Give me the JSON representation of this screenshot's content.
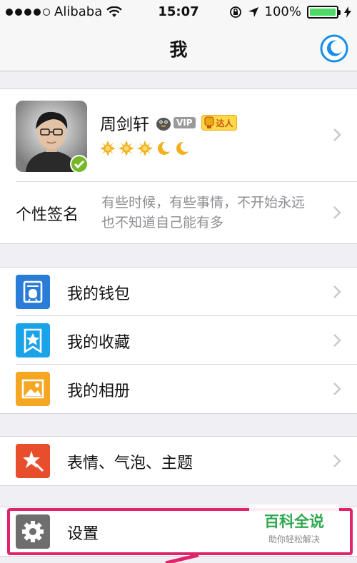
{
  "status_bar": {
    "carrier": "Alibaba",
    "time": "15:07",
    "battery": "100%",
    "battery_level": 1.0
  },
  "nav": {
    "title": "我",
    "right_icon": "moon-icon"
  },
  "profile": {
    "name": "周剑轩",
    "vip_badge": "VIP",
    "daren_badge": "达人",
    "level_icons": [
      "sun",
      "sun",
      "sun",
      "moon",
      "moon"
    ],
    "verified": true
  },
  "signature": {
    "label": "个性签名",
    "text": "有些时候，有些事情，不开始永远也不知道自己能有多"
  },
  "menu_group_1": [
    {
      "label": "我的钱包",
      "icon": "wallet-icon",
      "color": "#2a7dd7"
    },
    {
      "label": "我的收藏",
      "icon": "favorites-star-icon",
      "color": "#1aa3e8"
    },
    {
      "label": "我的相册",
      "icon": "photo-album-icon",
      "color": "#f5a623"
    }
  ],
  "menu_group_2": [
    {
      "label": "表情、气泡、主题",
      "icon": "sticker-theme-icon",
      "color": "#e84e2c"
    }
  ],
  "menu_group_3": [
    {
      "label": "设置",
      "icon": "gear-icon",
      "color": "#6e6e6e"
    }
  ],
  "watermark": {
    "title": "百科全说",
    "subtitle": "助你轻松解决"
  },
  "colors": {
    "highlight": "#e0236b",
    "accent_blue": "#1a8ee8",
    "verified_green": "#76b82a"
  }
}
